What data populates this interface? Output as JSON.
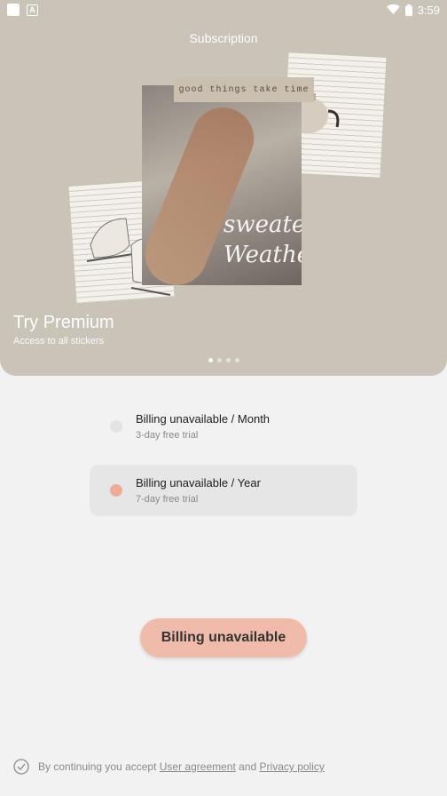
{
  "status_bar": {
    "time": "3:59",
    "app_icon_letter": "A"
  },
  "hero": {
    "title": "Subscription",
    "tape_text": "good things take time",
    "script_text_1": "sweater",
    "script_text_2": "Weather",
    "premium_title": "Try Premium",
    "premium_subtitle": "Access to all stickers",
    "pager": {
      "count": 4,
      "active_index": 0
    }
  },
  "plans": [
    {
      "name": "Billing unavailable / Month",
      "trial": "3-day free trial",
      "selected": false
    },
    {
      "name": "Billing unavailable / Year",
      "trial": "7-day free trial",
      "selected": true
    }
  ],
  "cta": {
    "label": "Billing unavailable"
  },
  "legal": {
    "prefix": "By continuing you accept",
    "user_agreement": "User agreement",
    "and": "and",
    "privacy_policy": "Privacy policy"
  },
  "colors": {
    "accent": "#f0bbaa",
    "radio_selected": "#efab98",
    "hero_bg": "#c9c3b8"
  },
  "icons": [
    "wifi-icon",
    "battery-icon",
    "check-circle-icon"
  ]
}
